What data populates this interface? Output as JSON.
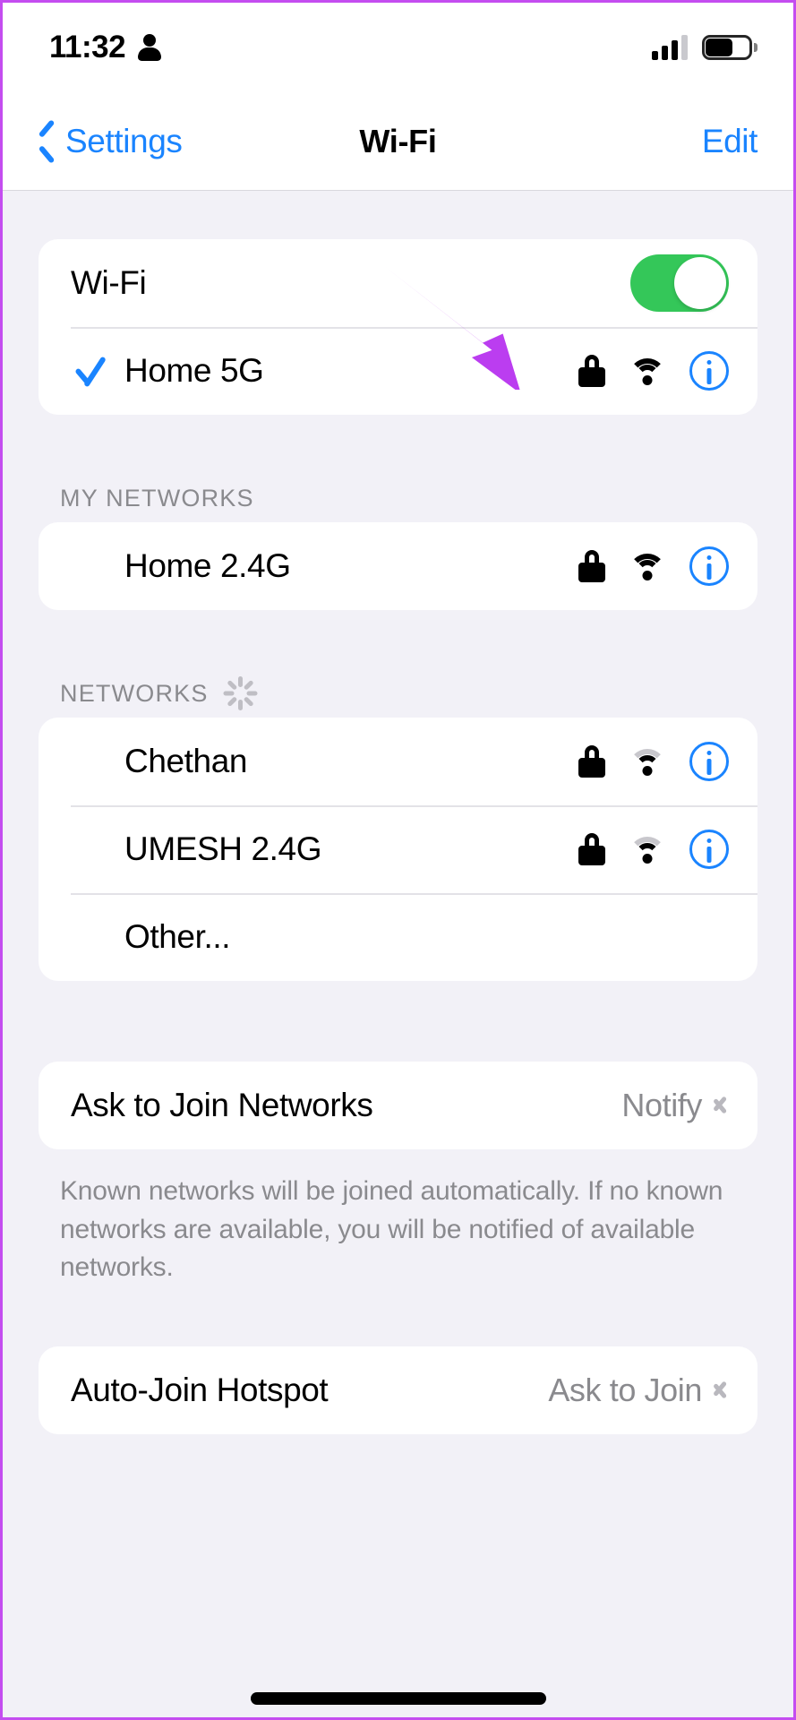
{
  "status_bar": {
    "time": "11:32",
    "person_icon": "person-icon",
    "cellular_icon": "cellular-signal-icon",
    "cellular_bars_filled": 3,
    "cellular_bars_total": 4,
    "battery_icon": "battery-icon",
    "battery_level_percent": 65
  },
  "nav": {
    "back_label": "Settings",
    "title": "Wi-Fi",
    "edit_label": "Edit"
  },
  "wifi_section": {
    "toggle_label": "Wi-Fi",
    "toggle_on": true,
    "connected": {
      "name": "Home 5G",
      "checked": true,
      "secured": true,
      "signal": "full"
    }
  },
  "my_networks": {
    "header": "MY NETWORKS",
    "items": [
      {
        "name": "Home 2.4G",
        "secured": true,
        "signal": "full"
      }
    ]
  },
  "networks": {
    "header": "NETWORKS",
    "scanning": true,
    "items": [
      {
        "name": "Chethan",
        "secured": true,
        "signal": "weak"
      },
      {
        "name": "UMESH 2.4G",
        "secured": true,
        "signal": "weak"
      }
    ],
    "other_label": "Other..."
  },
  "ask_to_join": {
    "label": "Ask to Join Networks",
    "value": "Notify",
    "footnote": "Known networks will be joined automatically. If no known networks are available, you will be notified of available networks."
  },
  "auto_join_hotspot": {
    "label": "Auto-Join Hotspot",
    "value": "Ask to Join"
  },
  "annotation": {
    "arrow_color": "#bb3df0"
  },
  "colors": {
    "accent_blue": "#1a84ff",
    "toggle_green": "#34c759",
    "background": "#f2f1f7",
    "card": "#ffffff",
    "secondary_text": "#8a8a8e"
  }
}
